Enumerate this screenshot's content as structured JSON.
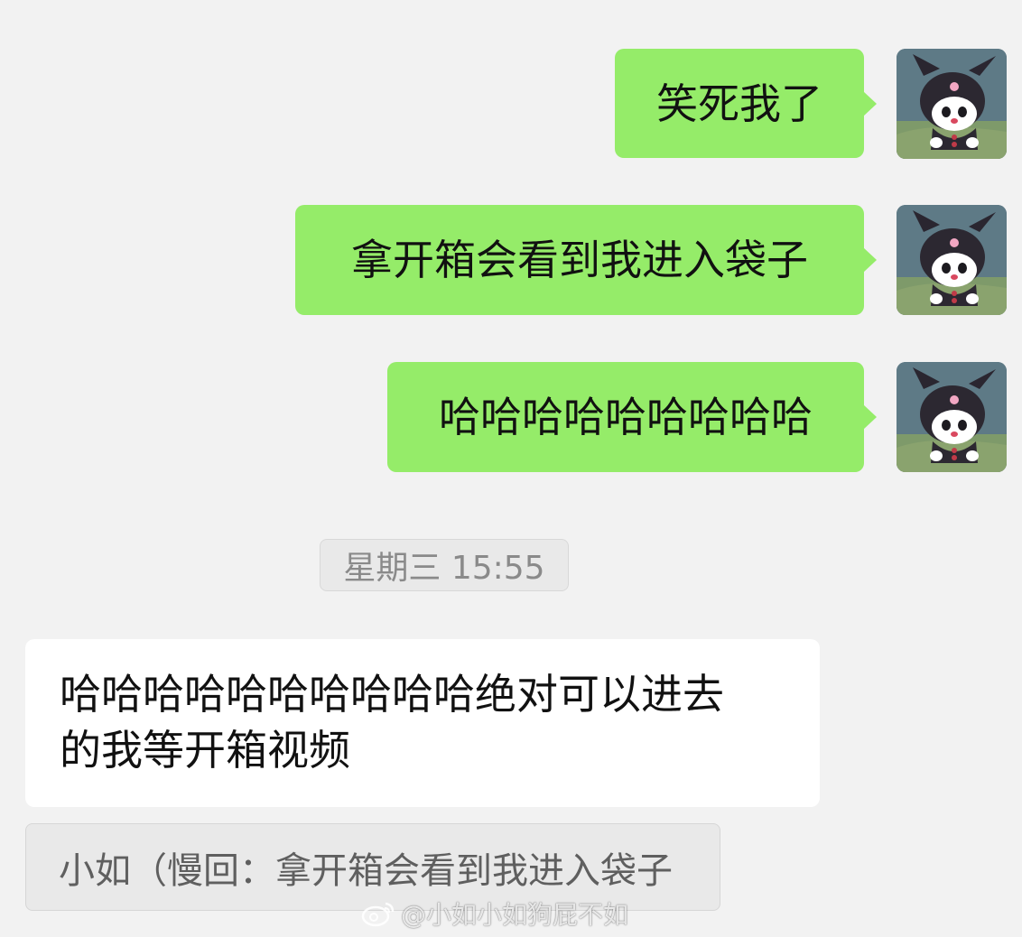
{
  "messages_out": [
    {
      "text": "笑死我了"
    },
    {
      "text": "拿开箱会看到我进入袋子"
    },
    {
      "text": "哈哈哈哈哈哈哈哈哈"
    }
  ],
  "timestamp": "星期三 15:55",
  "message_in": {
    "line1": "哈哈哈哈哈哈哈哈哈哈绝对可以进去",
    "line2": "的我等开箱视频"
  },
  "quote": {
    "text": "小如（慢回：拿开箱会看到我进入袋子"
  },
  "watermark": {
    "text": "@小如小如狗屁不如"
  },
  "colors": {
    "background": "#f2f2f2",
    "bubble_out": "#95ec69",
    "bubble_in": "#ffffff",
    "timestamp_bg": "#e9e9e9",
    "quote_bg": "#e9e9e9",
    "avatar_bg": "#5c7480"
  },
  "icons": {
    "avatar": "kuromi-avatar-icon",
    "watermark": "weibo-logo-icon"
  }
}
